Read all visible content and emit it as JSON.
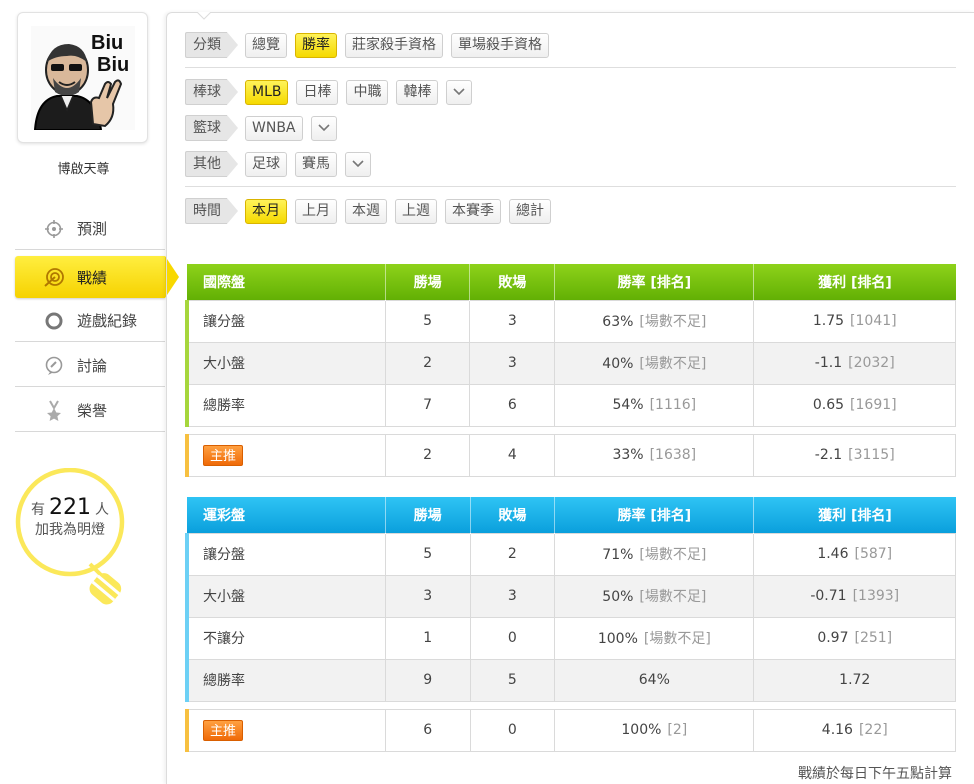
{
  "profile": {
    "avatar_text_line1": "Biu",
    "avatar_text_line2": "Biu",
    "username": "博啟天尊"
  },
  "nav": [
    {
      "label": "預測",
      "icon": "crosshair-icon"
    },
    {
      "label": "戰績",
      "icon": "target-arrow-icon",
      "active": true
    },
    {
      "label": "遊戲紀錄",
      "icon": "ring-icon"
    },
    {
      "label": "討論",
      "icon": "chat-icon"
    },
    {
      "label": "榮譽",
      "icon": "medal-icon"
    }
  ],
  "fans": {
    "prefix": "有",
    "count": "221",
    "suffix": "人",
    "line2": "加我為明燈"
  },
  "filters": {
    "category": {
      "label": "分類",
      "options": [
        "總覽",
        "勝率",
        "莊家殺手資格",
        "單場殺手資格"
      ],
      "selected": "勝率"
    },
    "baseball": {
      "label": "棒球",
      "options": [
        "MLB",
        "日棒",
        "中職",
        "韓棒"
      ],
      "selected": "MLB"
    },
    "basketball": {
      "label": "籃球",
      "options": [
        "WNBA"
      ],
      "selected": ""
    },
    "other": {
      "label": "其他",
      "options": [
        "足球",
        "賽馬"
      ],
      "selected": ""
    },
    "time": {
      "label": "時間",
      "options": [
        "本月",
        "上月",
        "本週",
        "上週",
        "本賽季",
        "總計"
      ],
      "selected": "本月"
    }
  },
  "intl_table": {
    "headers": [
      "國際盤",
      "勝場",
      "敗場",
      "勝率 [排名]",
      "獲利 [排名]"
    ],
    "rows": [
      {
        "name": "讓分盤",
        "win": "5",
        "loss": "3",
        "rate": "63%",
        "rate_rank": "[場數不足]",
        "profit": "1.75",
        "profit_rank": "[1041]"
      },
      {
        "name": "大小盤",
        "win": "2",
        "loss": "3",
        "rate": "40%",
        "rate_rank": "[場數不足]",
        "profit": "-1.1",
        "profit_rank": "[2032]"
      },
      {
        "name": "總勝率",
        "win": "7",
        "loss": "6",
        "rate": "54%",
        "rate_rank": "[1116]",
        "profit": "0.65",
        "profit_rank": "[1691]"
      }
    ],
    "pick": {
      "badge": "主推",
      "win": "2",
      "loss": "4",
      "rate": "33%",
      "rate_rank": "[1638]",
      "profit": "-2.1",
      "profit_rank": "[3115]"
    }
  },
  "lottery_table": {
    "headers": [
      "運彩盤",
      "勝場",
      "敗場",
      "勝率 [排名]",
      "獲利 [排名]"
    ],
    "rows": [
      {
        "name": "讓分盤",
        "win": "5",
        "loss": "2",
        "rate": "71%",
        "rate_rank": "[場數不足]",
        "profit": "1.46",
        "profit_rank": "[587]"
      },
      {
        "name": "大小盤",
        "win": "3",
        "loss": "3",
        "rate": "50%",
        "rate_rank": "[場數不足]",
        "profit": "-0.71",
        "profit_rank": "[1393]"
      },
      {
        "name": "不讓分",
        "win": "1",
        "loss": "0",
        "rate": "100%",
        "rate_rank": "[場數不足]",
        "profit": "0.97",
        "profit_rank": "[251]"
      },
      {
        "name": "總勝率",
        "win": "9",
        "loss": "5",
        "rate": "64%",
        "rate_rank": "",
        "profit": "1.72",
        "profit_rank": ""
      }
    ],
    "pick": {
      "badge": "主推",
      "win": "6",
      "loss": "0",
      "rate": "100%",
      "rate_rank": "[2]",
      "profit": "4.16",
      "profit_rank": "[22]"
    }
  },
  "footnote": "戰績於每日下午五點計算",
  "colors": {
    "accent_yellow": "#f5d900",
    "intl_header": "#6ab80a",
    "lottery_header": "#13a8e2",
    "pick_orange": "#f07a16"
  }
}
